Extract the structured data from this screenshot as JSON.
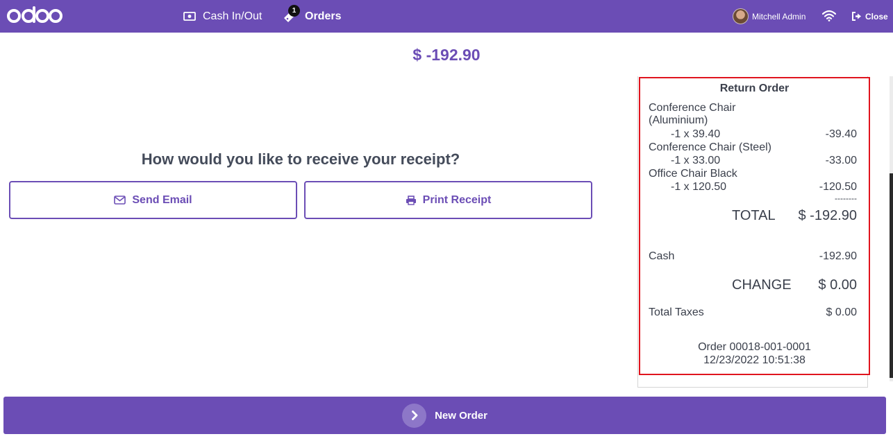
{
  "topbar": {
    "logo_text": "odoo",
    "cash_label": "Cash In/Out",
    "orders_label": "Orders",
    "orders_badge": "1",
    "user_name": "Mitchell Admin",
    "close_label": "Close"
  },
  "main": {
    "amount": "$ -192.90",
    "question": "How would you like to receive your receipt?",
    "send_email_label": "Send Email",
    "print_receipt_label": "Print Receipt"
  },
  "receipt": {
    "title": "Return Order",
    "lines": [
      {
        "name": "Conference Chair (Aluminium)",
        "qty_price": "-1 x 39.40",
        "total": "-39.40"
      },
      {
        "name": "Conference Chair (Steel)",
        "qty_price": "-1 x 33.00",
        "total": "-33.00"
      },
      {
        "name": "Office Chair Black",
        "qty_price": "-1 x 120.50",
        "total": "-120.50"
      }
    ],
    "separator": "--------",
    "total_label": "TOTAL",
    "total_value": "$ -192.90",
    "payment_label": "Cash",
    "payment_value": "-192.90",
    "change_label": "CHANGE",
    "change_value": "$ 0.00",
    "taxes_label": "Total Taxes",
    "taxes_value": "$ 0.00",
    "order_ref": "Order 00018-001-0001",
    "order_date": "12/23/2022 10:51:38"
  },
  "bottombar": {
    "new_order_label": "New Order"
  },
  "colors": {
    "brand": "#6b4db5",
    "highlight_border": "#e0141e"
  }
}
